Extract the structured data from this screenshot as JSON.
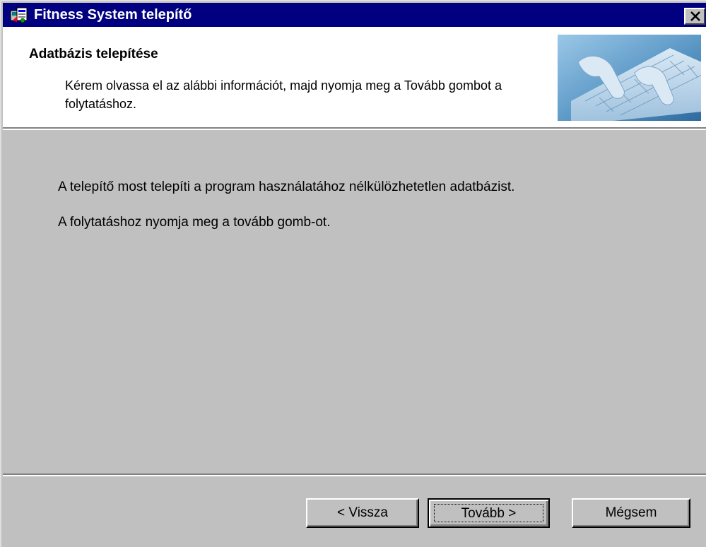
{
  "window": {
    "title": "Fitness System telepítő",
    "icons": {
      "app": "setup-app-icon",
      "close": "close-icon"
    }
  },
  "header": {
    "title": "Adatbázis telepítése",
    "description": "Kérem olvassa el az alábbi információt, majd nyomja meg a Tovább gombot a folytatáshoz.",
    "image": "keyboard-hands-image"
  },
  "body": {
    "lines": [
      "A telepítő most telepíti a program használatához nélkülözhetetlen adatbázist.",
      "A folytatáshoz nyomja meg a tovább gomb-ot."
    ]
  },
  "buttons": {
    "back": "< Vissza",
    "next": "Tovább >",
    "cancel": "Mégsem"
  },
  "colors": {
    "titlebar": "#000080",
    "face": "#c0c0c0",
    "header_bg": "#ffffff"
  }
}
